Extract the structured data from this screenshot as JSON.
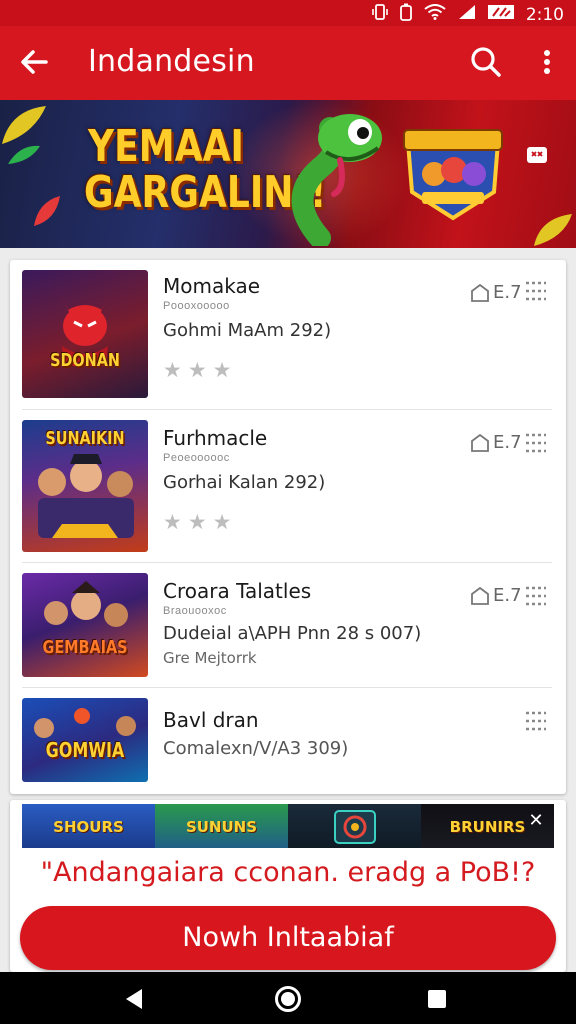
{
  "status_bar": {
    "time": "2:10"
  },
  "app_bar": {
    "title": "Indandesin",
    "back_icon": "arrow-left-icon",
    "search_icon": "search-icon",
    "more_icon": "more-vert-icon"
  },
  "banner": {
    "line1": "YEMAAI",
    "line2": "GARGALIN!!"
  },
  "items": [
    {
      "thumb_text": "SDONAN",
      "title": "Momakae",
      "subtitle": "Poooxooooo",
      "description": "Gohmi MaAm 292)",
      "size": "E.7",
      "rating": 3
    },
    {
      "thumb_text": "SUNAIKIN",
      "title": "Furhmacle",
      "subtitle": "Peoeoooooc",
      "description": "Gorhai Kalan 292)",
      "size": "E.7",
      "rating": 3
    },
    {
      "thumb_text": "GEMBAIAS",
      "title": "Croara Talatles",
      "subtitle": "Braouooxoc",
      "description": "Dudeial a\\APH Pnn 28 s 007)",
      "extra": "Gre Mejtorrk",
      "size": "E.7"
    },
    {
      "thumb_text": "GOMWIA",
      "title": "Bavl dran",
      "description": "Comalexn/V/A3 309)"
    }
  ],
  "ad": {
    "tiles": [
      "SHOURS",
      "SUNUNS",
      "",
      "BRUNIRS"
    ],
    "prompt": "\"Andangaiara cconan. eradg a PoB!?",
    "button_label": "Nowh Inltaabiaf"
  },
  "colors": {
    "primary": "#d6171f",
    "status_bar": "#c8101a",
    "button": "#d8161e"
  }
}
